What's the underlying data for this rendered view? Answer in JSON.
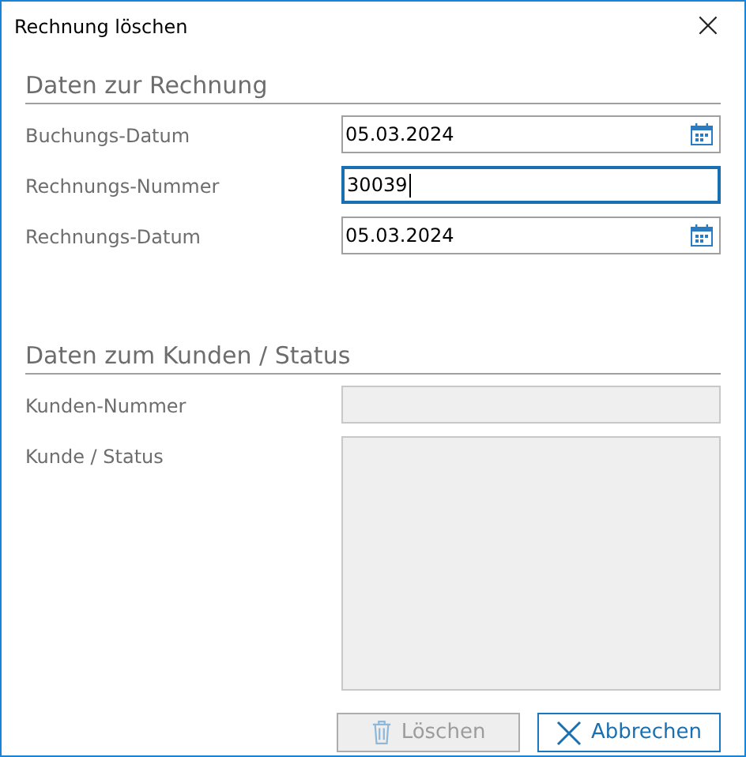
{
  "window": {
    "title": "Rechnung löschen",
    "close": "×"
  },
  "sections": [
    {
      "title": "Daten zur Rechnung",
      "fields": [
        {
          "label": "Buchungs-Datum",
          "kind": "date",
          "value": "05.03.2024",
          "focused": false,
          "disabled": false
        },
        {
          "label": "Rechnungs-Nummer",
          "kind": "text",
          "value": "30039",
          "focused": true,
          "disabled": false
        },
        {
          "label": "Rechnungs-Datum",
          "kind": "date",
          "value": "05.03.2024",
          "focused": false,
          "disabled": false
        }
      ]
    },
    {
      "title": "Daten zum Kunden / Status",
      "fields": [
        {
          "label": "Kunden-Nummer",
          "kind": "text",
          "focused": false,
          "disabled": true
        },
        {
          "label": "Kunde / Status",
          "kind": "textarea",
          "focused": false,
          "disabled": true
        }
      ]
    }
  ],
  "buttons": [
    {
      "label": "Löschen",
      "kind": "delete",
      "disabled": true
    },
    {
      "label": "Abbrechen",
      "kind": "cancel",
      "disabled": false
    }
  ]
}
